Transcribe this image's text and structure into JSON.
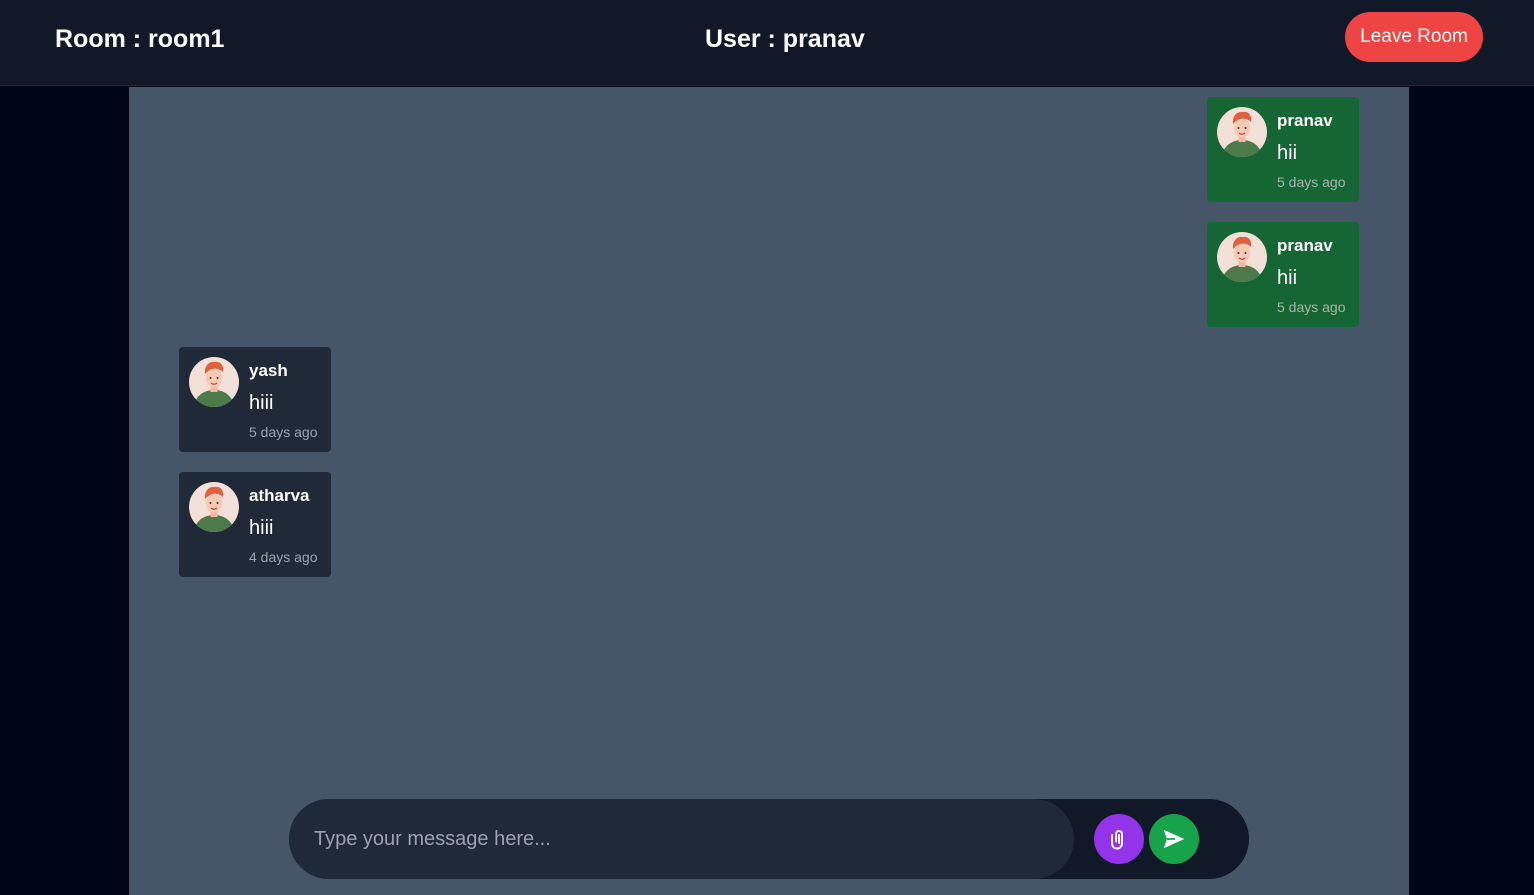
{
  "header": {
    "room_label": "Room : room1",
    "user_label": "User : pranav",
    "leave_button": "Leave Room"
  },
  "messages": [
    {
      "sender": "pranav",
      "text": "hii",
      "time": "5 days ago",
      "own": true
    },
    {
      "sender": "pranav",
      "text": "hii",
      "time": "5 days ago",
      "own": true
    },
    {
      "sender": "yash",
      "text": "hiii",
      "time": "5 days ago",
      "own": false
    },
    {
      "sender": "atharva",
      "text": "hiii",
      "time": "4 days ago",
      "own": false
    }
  ],
  "composer": {
    "placeholder": "Type your message here...",
    "attach_icon": "paperclip-icon",
    "send_icon": "send-icon"
  },
  "colors": {
    "header_bg": "#111827",
    "chat_bg": "#475569",
    "own_message_bg": "#166534",
    "other_message_bg": "#1f2937",
    "leave_button": "#ef4444",
    "attach_button": "#9333ea",
    "send_button": "#16a34a"
  }
}
